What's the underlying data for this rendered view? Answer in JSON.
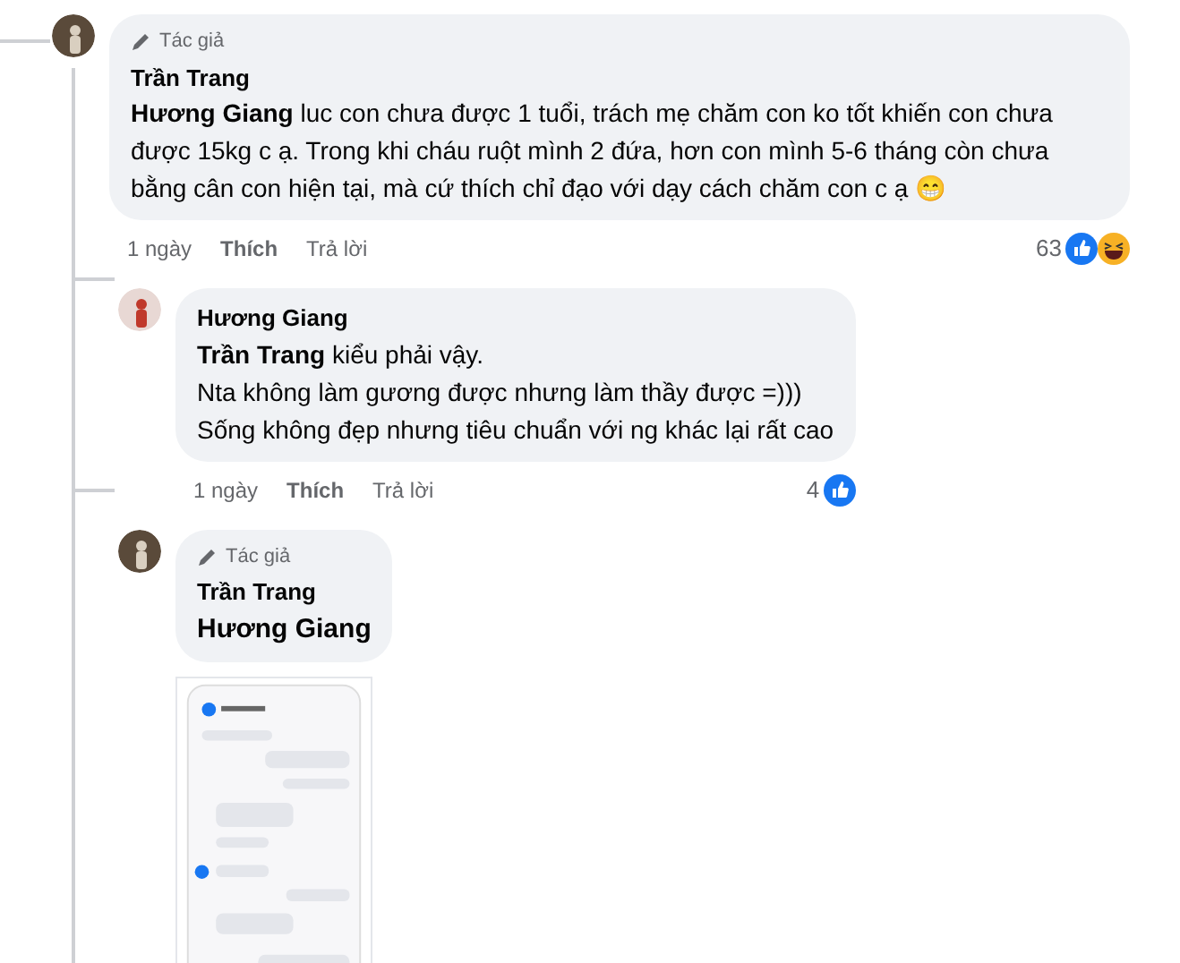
{
  "comments": [
    {
      "author_badge": "Tác giả",
      "author": "Trần Trang",
      "text": "**Hương Giang** luc con chưa được 1 tuổi, trách mẹ chăm con ko tốt khiến con chưa được 15kg c ạ. Trong khi cháu ruột mình 2 đứa, hơn con mình 5-6 tháng còn chưa bằng cân con hiện tại, mà cứ thích chỉ đạo với dạy cách chăm con c ạ 😁",
      "time": "1 ngày",
      "like": "Thích",
      "reply": "Trả lời",
      "reaction_count": "63",
      "reactions": [
        {
          "kind": "like"
        },
        {
          "kind": "haha"
        }
      ]
    },
    {
      "author": "Hương Giang",
      "text": "**Trần Trang** kiểu phải vậy.\nNta không làm gương được nhưng làm thầy được =)))\nSống không đẹp nhưng tiêu chuẩn với ng khác lại rất cao",
      "time": "1 ngày",
      "like": "Thích",
      "reply": "Trả lời",
      "reaction_count": "4",
      "reactions": [
        {
          "kind": "like"
        }
      ]
    },
    {
      "author_badge": "Tác giả",
      "author": "Trần Trang",
      "mention": "Hương Giang"
    }
  ]
}
